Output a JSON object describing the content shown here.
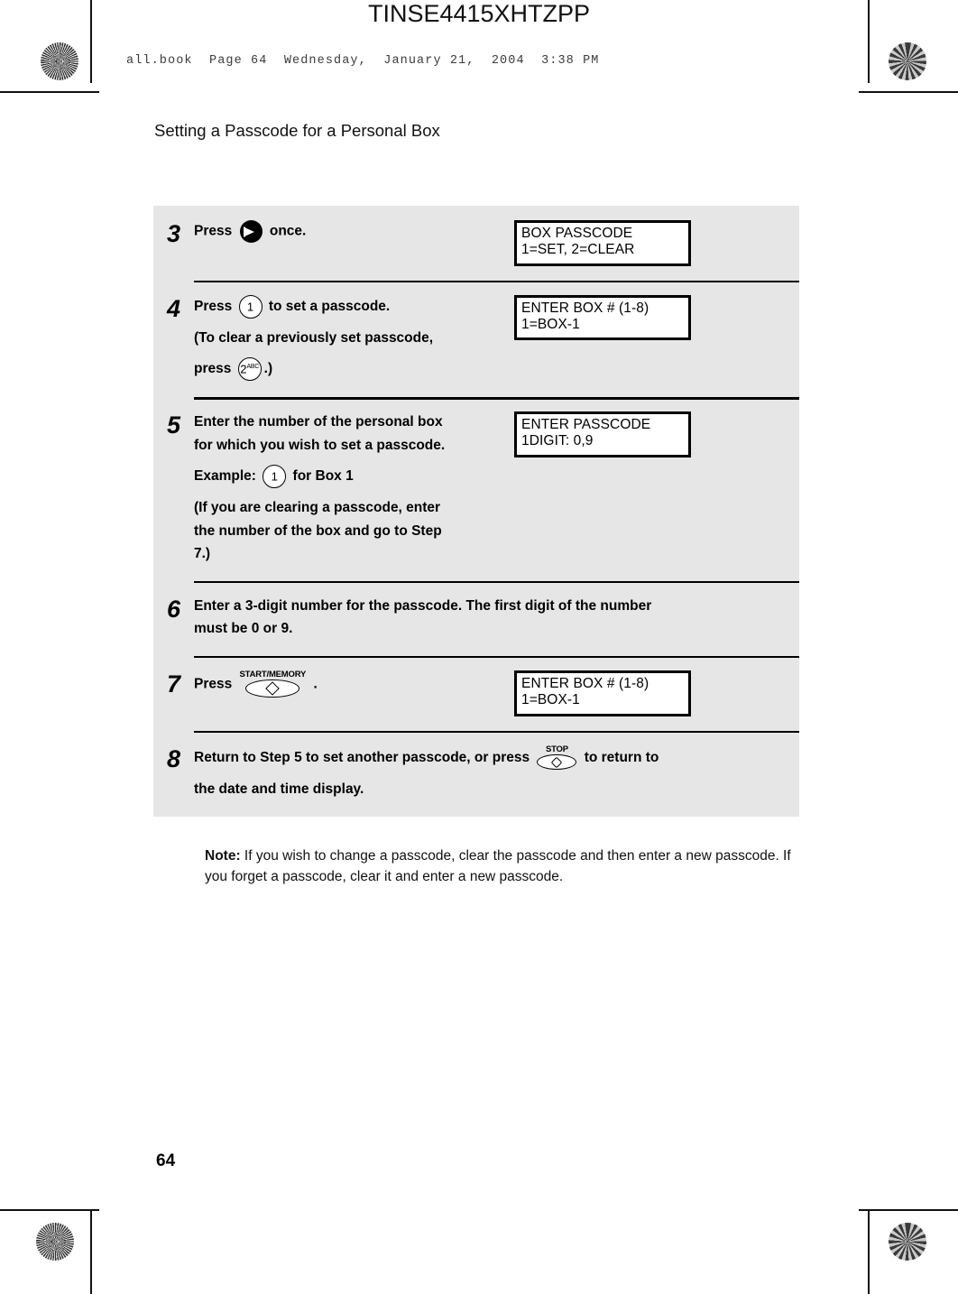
{
  "header": {
    "job_code": "TINSE4415XHTZPP",
    "book_line": "all.book  Page 64  Wednesday,  January 21,  2004  3:38 PM"
  },
  "page": {
    "heading": "Setting a Passcode for a Personal Box",
    "number": "64"
  },
  "steps": [
    {
      "number": "3",
      "lines": [
        {
          "pre": "Press ",
          "key": "arrow-right-key",
          "post": " once."
        }
      ],
      "lcd": {
        "line1": "BOX PASSCODE",
        "line2": "1=SET, 2=CLEAR"
      }
    },
    {
      "number": "4",
      "lines": [
        {
          "pre": "Press ",
          "key": "digit-1-key",
          "post": " to set a passcode."
        },
        {
          "pre": "(To clear a previously set passcode,",
          "key": null,
          "post": ""
        },
        {
          "pre": "press ",
          "key": "digit-2-abc-key",
          "post": ".)"
        }
      ],
      "lcd": {
        "line1": "ENTER BOX # (1-8)",
        "line2": "1=BOX-1"
      }
    },
    {
      "number": "5",
      "lines": [
        {
          "pre": "Enter the number of the personal box",
          "key": null,
          "post": ""
        },
        {
          "pre": "for which you wish to set a passcode.",
          "key": null,
          "post": ""
        },
        {
          "pre": "Example: ",
          "key": "digit-1-key",
          "post": " for Box 1"
        },
        {
          "pre": "(If you are clearing a passcode, enter",
          "key": null,
          "post": ""
        },
        {
          "pre": "the number of the box and go to Step",
          "key": null,
          "post": ""
        },
        {
          "pre": "7.)",
          "key": null,
          "post": ""
        }
      ],
      "lcd": {
        "line1": "ENTER PASSCODE",
        "line2": "1DIGIT: 0,9"
      }
    },
    {
      "number": "6",
      "lines": [
        {
          "pre": "Enter a 3-digit number for the passcode. The first digit of the number",
          "key": null,
          "post": ""
        },
        {
          "pre": "must be 0 or 9.",
          "key": null,
          "post": ""
        }
      ],
      "lcd": null
    },
    {
      "number": "7",
      "lines": [
        {
          "pre": "Press ",
          "key": "start-memory-key",
          "post": " ."
        }
      ],
      "lcd": {
        "line1": "ENTER BOX # (1-8)",
        "line2": "1=BOX-1"
      }
    },
    {
      "number": "8",
      "lines": [
        {
          "pre": "Return to Step 5 to set another passcode, or press ",
          "key": "stop-key",
          "post": " to return to"
        },
        {
          "pre": "the date and time display.",
          "key": null,
          "post": ""
        }
      ],
      "lcd": null
    }
  ],
  "keys": {
    "digit_1_label": "1",
    "digit_2_label": "2",
    "digit_2_sub": "ABC",
    "start_memory_label": "START/MEMORY",
    "stop_label": "STOP"
  },
  "note": {
    "label": "Note:",
    "text": " If you wish to change a passcode, clear the passcode and then enter a new passcode. If you forget a passcode, clear it and enter a new passcode."
  }
}
